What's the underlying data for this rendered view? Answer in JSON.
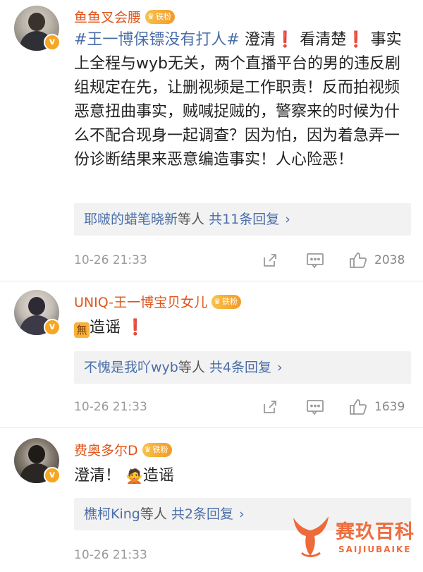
{
  "comments": [
    {
      "username": "鱼鱼叉会腰",
      "badge": "铁粉",
      "hashtag": "#王一博保镖没有打人#",
      "t1": " 澄清",
      "t2": " 看清楚",
      "t3": " 事实上全程与wyb无关，两个直播平台的男的违反剧组规定在先，让删视频是工作职责！反而拍视频恶意扭曲事实，贼喊捉贼的，警察来的时候为什么不配合现身一起调查？因为怕，因为着急弄一份诊断结果来恶意编造事实！人心险恶！",
      "reply_users": "耶啵的蜡笔晓新",
      "reply_mid": "等人",
      "reply_count": "共11条回复",
      "time": "10-26 21:33",
      "likes": "2038"
    },
    {
      "username": "UNIQ-王一博宝贝女儿",
      "badge": "铁粉",
      "emoji": "無",
      "t1": "造谣",
      "reply_users": "不愧是我吖wyb",
      "reply_mid": "等人",
      "reply_count": "共4条回复",
      "time": "10-26 21:33",
      "likes": "1639"
    },
    {
      "username": "费奥多尔D",
      "badge": "铁粉",
      "t1": "澄清！",
      "t2": "造谣",
      "reply_users": "樵柯King",
      "reply_mid": "等人",
      "reply_count": "共2条回复",
      "time": "10-26 21:33"
    }
  ],
  "watermark": {
    "title": "赛玖百科",
    "subtitle": "SAIJIUBAIKE"
  },
  "icons": [
    "verified-v-icon",
    "crown-icon",
    "share-icon",
    "comment-icon",
    "like-icon",
    "chevron-right-icon"
  ],
  "colors": {
    "username": "#e0541a",
    "link": "#4a6ea9",
    "exclamation": "#e0261a",
    "muted": "#999999",
    "reply_bg": "#f2f2f2",
    "badge": "#f5a623"
  }
}
